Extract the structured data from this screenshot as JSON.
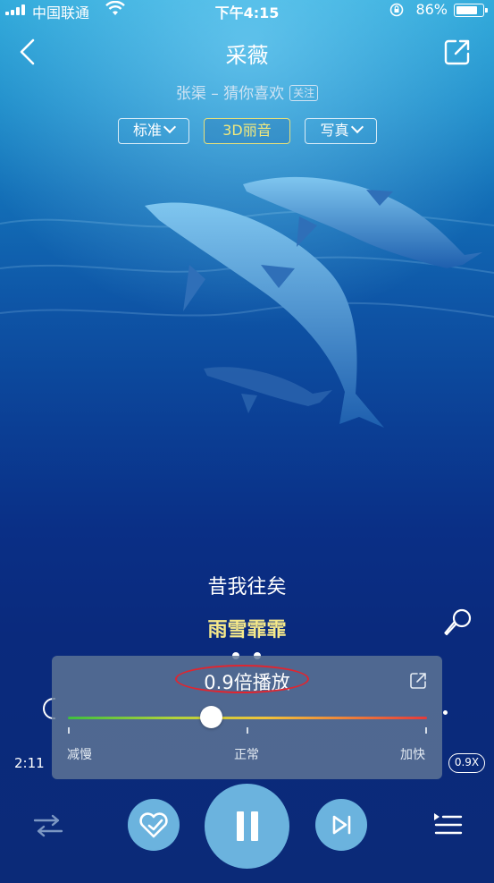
{
  "status_bar": {
    "carrier": "中国联通",
    "time": "下午4:15",
    "battery": "86%",
    "battery_level": 0.86
  },
  "header": {
    "title": "采薇",
    "artist_line": "张渠 – 猜你喜欢",
    "follow_label": "关注"
  },
  "chips": [
    {
      "label": "标准"
    },
    {
      "label": "3D丽音"
    },
    {
      "label": "写真"
    }
  ],
  "lyrics": {
    "line1": "昔我往矣",
    "line2": "雨雪霏霏"
  },
  "speed_panel": {
    "title": "0.9倍播放",
    "level": 0.4,
    "labels": {
      "slow": "减慢",
      "normal": "正常",
      "fast": "加快"
    }
  },
  "player": {
    "elapsed": "2:11",
    "speed_badge": "0.9X"
  },
  "colors": {
    "accent_gold": "#f1e87d",
    "button_blue": "#6bb3de",
    "annotation_red": "#e1252f"
  }
}
